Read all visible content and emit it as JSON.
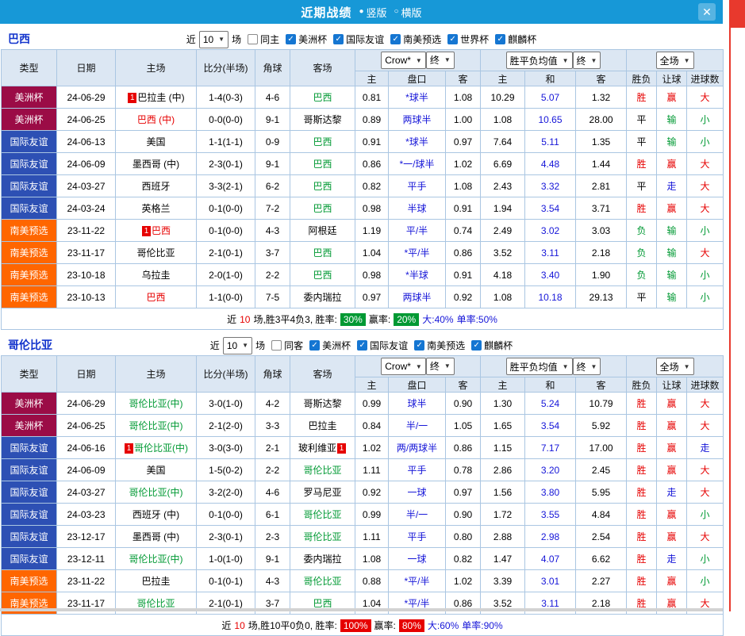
{
  "colors": {
    "titlebar_blue": "#1798d7",
    "red_text": "#e60000",
    "green_text": "#009933",
    "blue_text": "#1515d8",
    "rail_red": "#e8392d",
    "type_colors": {
      "美洲杯": "#9b0c46",
      "国际友谊": "#2d50b4",
      "南美预选": "#ff6600"
    }
  },
  "titlebar": {
    "title": "近期战绩",
    "radios": [
      {
        "label": "竖版",
        "selected": true
      },
      {
        "label": "横版",
        "selected": false
      }
    ],
    "close": "✕"
  },
  "table_header": {
    "type": "类型",
    "date": "日期",
    "home": "主场",
    "score": "比分(半场)",
    "corner": "角球",
    "away": "客场",
    "bookie_select": "Crow*",
    "bookie_final": "终",
    "europe_select": "胜平负均值",
    "europe_final": "终",
    "full_select": "全场",
    "sub": [
      "主",
      "盘口",
      "客",
      "主",
      "和",
      "客",
      "胜负",
      "让球",
      "进球数"
    ]
  },
  "sections": [
    {
      "team": "巴西",
      "filter": {
        "near": "近",
        "count": "10",
        "unit": "场",
        "same": {
          "label": "同主",
          "checked": false
        },
        "cups": [
          {
            "label": "美洲杯",
            "checked": true
          },
          {
            "label": "国际友谊",
            "checked": true
          },
          {
            "label": "南美预选",
            "checked": true
          },
          {
            "label": "世界杯",
            "checked": true
          },
          {
            "label": "麒麟杯",
            "checked": true
          }
        ]
      },
      "rows": [
        {
          "type": "美洲杯",
          "date": "24-06-29",
          "home": "巴拉圭 (中)",
          "hc": "k",
          "hb": "1",
          "score": "1-4(0-3)",
          "corner": "4-6",
          "away": "巴西",
          "ac": "g",
          "a1": "0.81",
          "hcp": "*球半",
          "a2": "1.08",
          "e1": "10.29",
          "e2": "5.07",
          "e3": "1.32",
          "r1": "胜",
          "c1": "r",
          "r2": "赢",
          "c2": "r",
          "r3": "大",
          "c3": "r"
        },
        {
          "type": "美洲杯",
          "date": "24-06-25",
          "home": "巴西 (中)",
          "hc": "r",
          "score": "0-0(0-0)",
          "corner": "9-1",
          "away": "哥斯达黎",
          "ac": "k",
          "a1": "0.89",
          "hcp": "两球半",
          "a2": "1.00",
          "e1": "1.08",
          "e2": "10.65",
          "e3": "28.00",
          "r1": "平",
          "c1": "k",
          "r2": "输",
          "c2": "g",
          "r3": "小",
          "c3": "g"
        },
        {
          "type": "国际友谊",
          "date": "24-06-13",
          "home": "美国",
          "hc": "k",
          "score": "1-1(1-1)",
          "corner": "0-9",
          "away": "巴西",
          "ac": "g",
          "a1": "0.91",
          "hcp": "*球半",
          "a2": "0.97",
          "e1": "7.64",
          "e2": "5.11",
          "e3": "1.35",
          "r1": "平",
          "c1": "k",
          "r2": "输",
          "c2": "g",
          "r3": "小",
          "c3": "g"
        },
        {
          "type": "国际友谊",
          "date": "24-06-09",
          "home": "墨西哥 (中)",
          "hc": "k",
          "score": "2-3(0-1)",
          "corner": "9-1",
          "away": "巴西",
          "ac": "g",
          "a1": "0.86",
          "hcp": "*一/球半",
          "a2": "1.02",
          "e1": "6.69",
          "e2": "4.48",
          "e3": "1.44",
          "r1": "胜",
          "c1": "r",
          "r2": "赢",
          "c2": "r",
          "r3": "大",
          "c3": "r"
        },
        {
          "type": "国际友谊",
          "date": "24-03-27",
          "home": "西班牙",
          "hc": "k",
          "score": "3-3(2-1)",
          "corner": "6-2",
          "away": "巴西",
          "ac": "g",
          "a1": "0.82",
          "hcp": "平手",
          "a2": "1.08",
          "e1": "2.43",
          "e2": "3.32",
          "e3": "2.81",
          "r1": "平",
          "c1": "k",
          "r2": "走",
          "c2": "b",
          "r3": "大",
          "c3": "r"
        },
        {
          "type": "国际友谊",
          "date": "24-03-24",
          "home": "英格兰",
          "hc": "k",
          "score": "0-1(0-0)",
          "corner": "7-2",
          "away": "巴西",
          "ac": "g",
          "a1": "0.98",
          "hcp": "半球",
          "a2": "0.91",
          "e1": "1.94",
          "e2": "3.54",
          "e3": "3.71",
          "r1": "胜",
          "c1": "r",
          "r2": "赢",
          "c2": "r",
          "r3": "大",
          "c3": "r"
        },
        {
          "type": "南美预选",
          "date": "23-11-22",
          "home": "巴西",
          "hc": "r",
          "hb": "1",
          "score": "0-1(0-0)",
          "corner": "4-3",
          "away": "阿根廷",
          "ac": "k",
          "a1": "1.19",
          "hcp": "平/半",
          "a2": "0.74",
          "e1": "2.49",
          "e2": "3.02",
          "e3": "3.03",
          "r1": "负",
          "c1": "g",
          "r2": "输",
          "c2": "g",
          "r3": "小",
          "c3": "g"
        },
        {
          "type": "南美预选",
          "date": "23-11-17",
          "home": "哥伦比亚",
          "hc": "k",
          "score": "2-1(0-1)",
          "corner": "3-7",
          "away": "巴西",
          "ac": "g",
          "a1": "1.04",
          "hcp": "*平/半",
          "a2": "0.86",
          "e1": "3.52",
          "e2": "3.11",
          "e3": "2.18",
          "r1": "负",
          "c1": "g",
          "r2": "输",
          "c2": "g",
          "r3": "大",
          "c3": "r"
        },
        {
          "type": "南美预选",
          "date": "23-10-18",
          "home": "乌拉圭",
          "hc": "k",
          "score": "2-0(1-0)",
          "corner": "2-2",
          "away": "巴西",
          "ac": "g",
          "a1": "0.98",
          "hcp": "*半球",
          "a2": "0.91",
          "e1": "4.18",
          "e2": "3.40",
          "e3": "1.90",
          "r1": "负",
          "c1": "g",
          "r2": "输",
          "c2": "g",
          "r3": "小",
          "c3": "g"
        },
        {
          "type": "南美预选",
          "date": "23-10-13",
          "home": "巴西",
          "hc": "r",
          "score": "1-1(0-0)",
          "corner": "7-5",
          "away": "委内瑞拉",
          "ac": "k",
          "a1": "0.97",
          "hcp": "两球半",
          "a2": "0.92",
          "e1": "1.08",
          "e2": "10.18",
          "e3": "29.13",
          "r1": "平",
          "c1": "k",
          "r2": "输",
          "c2": "g",
          "r3": "小",
          "c3": "g"
        }
      ],
      "footer": {
        "pre": "近",
        "count": "10",
        "mid": "场,胜3平4负3, 胜率:",
        "rate1": "30%",
        "lbl2": "赢率:",
        "rate2": "20%",
        "badge": "green",
        "big": "大:40%",
        "single": "单率:50%"
      }
    },
    {
      "team": "哥伦比亚",
      "filter": {
        "near": "近",
        "count": "10",
        "unit": "场",
        "same": {
          "label": "同客",
          "checked": false
        },
        "cups": [
          {
            "label": "美洲杯",
            "checked": true
          },
          {
            "label": "国际友谊",
            "checked": true
          },
          {
            "label": "南美预选",
            "checked": true
          },
          {
            "label": "麒麟杯",
            "checked": true
          }
        ]
      },
      "rows": [
        {
          "type": "美洲杯",
          "date": "24-06-29",
          "home": "哥伦比亚(中)",
          "hc": "g",
          "score": "3-0(1-0)",
          "corner": "4-2",
          "away": "哥斯达黎",
          "ac": "k",
          "a1": "0.99",
          "hcp": "球半",
          "a2": "0.90",
          "e1": "1.30",
          "e2": "5.24",
          "e3": "10.79",
          "r1": "胜",
          "c1": "r",
          "r2": "赢",
          "c2": "r",
          "r3": "大",
          "c3": "r"
        },
        {
          "type": "美洲杯",
          "date": "24-06-25",
          "home": "哥伦比亚(中)",
          "hc": "g",
          "score": "2-1(2-0)",
          "corner": "3-3",
          "away": "巴拉圭",
          "ac": "k",
          "a1": "0.84",
          "hcp": "半/一",
          "a2": "1.05",
          "e1": "1.65",
          "e2": "3.54",
          "e3": "5.92",
          "r1": "胜",
          "c1": "r",
          "r2": "赢",
          "c2": "r",
          "r3": "大",
          "c3": "r"
        },
        {
          "type": "国际友谊",
          "date": "24-06-16",
          "home": "哥伦比亚(中)",
          "hc": "g",
          "hb": "1",
          "score": "3-0(3-0)",
          "corner": "2-1",
          "away": "玻利维亚",
          "ac": "k",
          "ab": "1",
          "a1": "1.02",
          "hcp": "两/两球半",
          "a2": "0.86",
          "e1": "1.15",
          "e2": "7.17",
          "e3": "17.00",
          "r1": "胜",
          "c1": "r",
          "r2": "赢",
          "c2": "r",
          "r3": "走",
          "c3": "b"
        },
        {
          "type": "国际友谊",
          "date": "24-06-09",
          "home": "美国",
          "hc": "k",
          "score": "1-5(0-2)",
          "corner": "2-2",
          "away": "哥伦比亚",
          "ac": "g",
          "a1": "1.11",
          "hcp": "平手",
          "a2": "0.78",
          "e1": "2.86",
          "e2": "3.20",
          "e3": "2.45",
          "r1": "胜",
          "c1": "r",
          "r2": "赢",
          "c2": "r",
          "r3": "大",
          "c3": "r"
        },
        {
          "type": "国际友谊",
          "date": "24-03-27",
          "home": "哥伦比亚(中)",
          "hc": "g",
          "score": "3-2(2-0)",
          "corner": "4-6",
          "away": "罗马尼亚",
          "ac": "k",
          "a1": "0.92",
          "hcp": "一球",
          "a2": "0.97",
          "e1": "1.56",
          "e2": "3.80",
          "e3": "5.95",
          "r1": "胜",
          "c1": "r",
          "r2": "走",
          "c2": "b",
          "r3": "大",
          "c3": "r"
        },
        {
          "type": "国际友谊",
          "date": "24-03-23",
          "home": "西班牙 (中)",
          "hc": "k",
          "score": "0-1(0-0)",
          "corner": "6-1",
          "away": "哥伦比亚",
          "ac": "g",
          "a1": "0.99",
          "hcp": "半/一",
          "a2": "0.90",
          "e1": "1.72",
          "e2": "3.55",
          "e3": "4.84",
          "r1": "胜",
          "c1": "r",
          "r2": "赢",
          "c2": "r",
          "r3": "小",
          "c3": "g"
        },
        {
          "type": "国际友谊",
          "date": "23-12-17",
          "home": "墨西哥 (中)",
          "hc": "k",
          "score": "2-3(0-1)",
          "corner": "2-3",
          "away": "哥伦比亚",
          "ac": "g",
          "a1": "1.11",
          "hcp": "平手",
          "a2": "0.80",
          "e1": "2.88",
          "e2": "2.98",
          "e3": "2.54",
          "r1": "胜",
          "c1": "r",
          "r2": "赢",
          "c2": "r",
          "r3": "大",
          "c3": "r"
        },
        {
          "type": "国际友谊",
          "date": "23-12-11",
          "home": "哥伦比亚(中)",
          "hc": "g",
          "score": "1-0(1-0)",
          "corner": "9-1",
          "away": "委内瑞拉",
          "ac": "k",
          "a1": "1.08",
          "hcp": "一球",
          "a2": "0.82",
          "e1": "1.47",
          "e2": "4.07",
          "e3": "6.62",
          "r1": "胜",
          "c1": "r",
          "r2": "走",
          "c2": "b",
          "r3": "小",
          "c3": "g"
        },
        {
          "type": "南美预选",
          "date": "23-11-22",
          "home": "巴拉圭",
          "hc": "k",
          "score": "0-1(0-1)",
          "corner": "4-3",
          "away": "哥伦比亚",
          "ac": "g",
          "a1": "0.88",
          "hcp": "*平/半",
          "a2": "1.02",
          "e1": "3.39",
          "e2": "3.01",
          "e3": "2.27",
          "r1": "胜",
          "c1": "r",
          "r2": "赢",
          "c2": "r",
          "r3": "小",
          "c3": "g"
        },
        {
          "type": "南美预选",
          "date": "23-11-17",
          "home": "哥伦比亚",
          "hc": "g",
          "score": "2-1(0-1)",
          "corner": "3-7",
          "away": "巴西",
          "ac": "g",
          "a1": "1.04",
          "hcp": "*平/半",
          "a2": "0.86",
          "e1": "3.52",
          "e2": "3.11",
          "e3": "2.18",
          "r1": "胜",
          "c1": "r",
          "r2": "赢",
          "c2": "r",
          "r3": "大",
          "c3": "r"
        }
      ],
      "footer": {
        "pre": "近",
        "count": "10",
        "mid": "场,胜10平0负0, 胜率:",
        "rate1": "100%",
        "lbl2": "赢率:",
        "rate2": "80%",
        "badge": "red",
        "big": "大:60%",
        "single": "单率:90%"
      }
    }
  ]
}
